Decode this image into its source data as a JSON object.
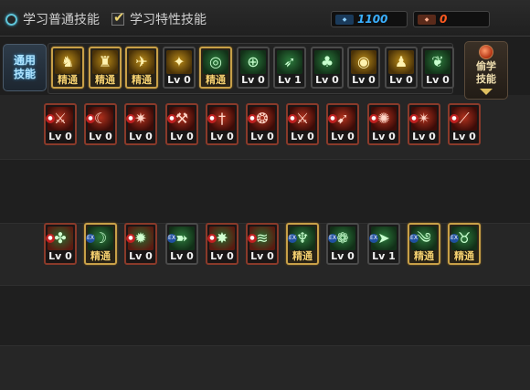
{
  "tabs": [
    {
      "label": "学习普通技能",
      "selected": false
    },
    {
      "label": "学习特性技能",
      "selected": true
    }
  ],
  "stats": [
    {
      "icon": "sp-points-icon",
      "value": "1100",
      "color": "#3ab0ff"
    },
    {
      "icon": "tp-points-icon",
      "value": "0",
      "color": "#ff5a20"
    }
  ],
  "side_left": {
    "label": "通用技能"
  },
  "side_right": {
    "label": "偷学技能"
  },
  "row1": [
    {
      "icon": "sit-icon",
      "level": "精通",
      "mastered": true,
      "color": "yellow"
    },
    {
      "icon": "crouch-icon",
      "level": "精通",
      "mastered": true,
      "color": "yellow"
    },
    {
      "icon": "kick-icon",
      "level": "精通",
      "mastered": true,
      "color": "yellow"
    },
    {
      "icon": "wings-icon",
      "level": "Lv 0",
      "mastered": false,
      "color": "yellow"
    },
    {
      "icon": "crosshair-icon",
      "level": "精通",
      "mastered": true,
      "color": "green"
    },
    {
      "icon": "crosshair-small-icon",
      "level": "Lv 0",
      "mastered": false,
      "color": "green"
    },
    {
      "icon": "aim-icon",
      "level": "Lv 1",
      "mastered": false,
      "color": "green"
    },
    {
      "icon": "mushroom-icon",
      "level": "Lv 0",
      "mastered": false,
      "color": "green"
    },
    {
      "icon": "eye-orb-icon",
      "level": "Lv 0",
      "mastered": false,
      "color": "yellow"
    },
    {
      "icon": "flex-icon",
      "level": "Lv 0",
      "mastered": false,
      "color": "yellow"
    },
    {
      "icon": "leaf-icon",
      "level": "Lv 0",
      "mastered": false,
      "color": "green"
    }
  ],
  "row2": [
    {
      "icon": "blade-icon",
      "level": "Lv 0",
      "badge": true
    },
    {
      "icon": "arc-icon",
      "level": "Lv 0",
      "badge": true
    },
    {
      "icon": "spark-icon",
      "level": "Lv 0",
      "badge": true
    },
    {
      "icon": "claw-icon",
      "level": "Lv 0",
      "badge": true
    },
    {
      "icon": "dagger-icon",
      "level": "Lv 0",
      "badge": true
    },
    {
      "icon": "swirl-icon",
      "level": "Lv 0",
      "badge": true
    },
    {
      "icon": "sword-icon",
      "level": "Lv 0",
      "badge": true
    },
    {
      "icon": "crossbow-icon",
      "level": "Lv 0",
      "badge": true
    },
    {
      "icon": "burst-icon",
      "level": "Lv 0",
      "badge": true
    },
    {
      "icon": "shuriken-icon",
      "level": "Lv 0",
      "badge": true
    },
    {
      "icon": "slash-icon",
      "level": "Lv 0",
      "badge": true
    }
  ],
  "row3": [
    {
      "icon": "clover-icon",
      "level": "Lv 0",
      "mastered": false,
      "badge": "red"
    },
    {
      "icon": "crescent-icon",
      "level": "精通",
      "mastered": true,
      "badge": "ex"
    },
    {
      "icon": "flare-icon",
      "level": "Lv 0",
      "mastered": false,
      "badge": "red"
    },
    {
      "icon": "runner-icon",
      "level": "Lv 0",
      "mastered": false,
      "badge": "ex"
    },
    {
      "icon": "explosion-icon",
      "level": "Lv 0",
      "mastered": false,
      "badge": "red"
    },
    {
      "icon": "wind-icon",
      "level": "Lv 0",
      "mastered": false,
      "badge": "red"
    },
    {
      "icon": "leap-icon",
      "level": "精通",
      "mastered": true,
      "badge": "ex"
    },
    {
      "icon": "vortex-icon",
      "level": "Lv 0",
      "mastered": false,
      "badge": "ex"
    },
    {
      "icon": "thrust-icon",
      "level": "Lv 1",
      "mastered": false,
      "badge": "ex"
    },
    {
      "icon": "gale-icon",
      "level": "精通",
      "mastered": true,
      "badge": "ex"
    },
    {
      "icon": "beast-icon",
      "level": "精通",
      "mastered": true,
      "badge": "ex"
    }
  ]
}
